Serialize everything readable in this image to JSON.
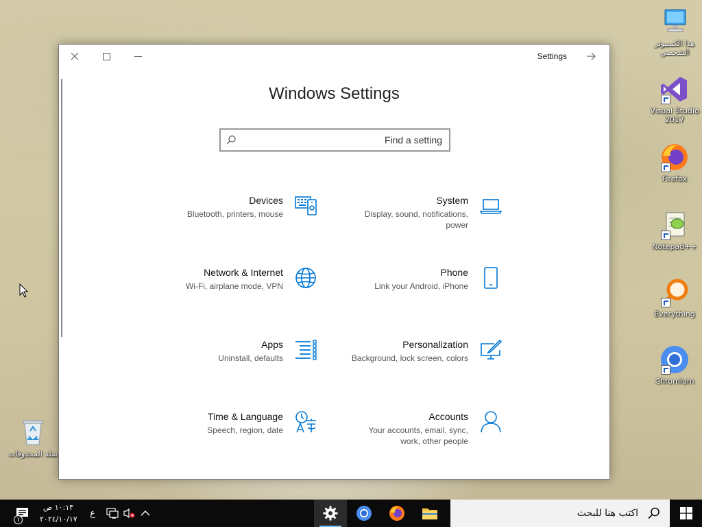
{
  "desktop": {
    "icons": [
      {
        "label": "هذا الكمبيوتر الشخصي"
      },
      {
        "label": "Visual Studio 2017"
      },
      {
        "label": "Firefox"
      },
      {
        "label": "Notepad++"
      },
      {
        "label": "Everything"
      },
      {
        "label": "Chromium"
      },
      {
        "label": "سلة المحذوفات"
      }
    ]
  },
  "window": {
    "title": "Settings",
    "heading": "Windows Settings",
    "search_placeholder": "Find a setting"
  },
  "tiles": [
    {
      "title": "Devices",
      "subtitle": "Bluetooth, printers, mouse",
      "icon": "devices-icon"
    },
    {
      "title": "System",
      "subtitle": "Display, sound, notifications, power",
      "icon": "laptop-icon"
    },
    {
      "title": "Network & Internet",
      "subtitle": "Wi-Fi, airplane mode, VPN",
      "icon": "globe-icon"
    },
    {
      "title": "Phone",
      "subtitle": "Link your Android, iPhone",
      "icon": "phone-icon"
    },
    {
      "title": "Apps",
      "subtitle": "Uninstall, defaults",
      "icon": "apps-list-icon"
    },
    {
      "title": "Personalization",
      "subtitle": "Background, lock screen, colors",
      "icon": "paint-monitor-icon"
    },
    {
      "title": "Time & Language",
      "subtitle": "Speech, region, date",
      "icon": "time-language-icon"
    },
    {
      "title": "Accounts",
      "subtitle": "Your accounts, email, sync, work, other people",
      "icon": "person-icon"
    }
  ],
  "taskbar": {
    "search_placeholder": "اكتب هنا للبحث",
    "time": "١٠:١٣ ص",
    "date": "٢٠٢٤/١٠/١٧",
    "language": "ع",
    "notification_count": "١",
    "apps": [
      "settings",
      "chromium",
      "firefox",
      "file-explorer"
    ]
  }
}
